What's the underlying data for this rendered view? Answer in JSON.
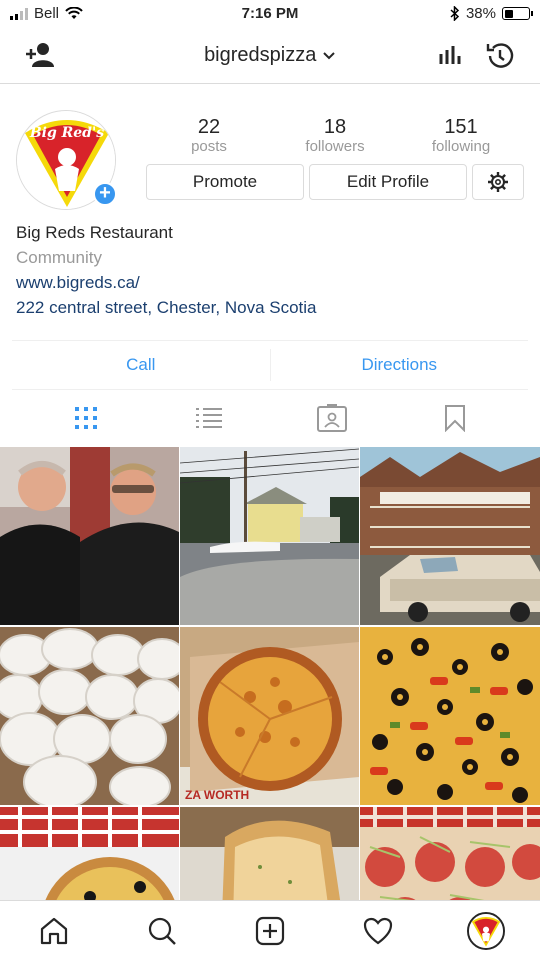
{
  "status": {
    "carrier": "Bell",
    "time": "7:16 PM",
    "battery": "38%",
    "battery_level": 0.38
  },
  "header": {
    "username": "bigredspizza"
  },
  "profile": {
    "avatar_text": "Big Red's",
    "stats": [
      {
        "value": "22",
        "label": "posts"
      },
      {
        "value": "18",
        "label": "followers"
      },
      {
        "value": "151",
        "label": "following"
      }
    ],
    "promote_label": "Promote",
    "edit_label": "Edit Profile",
    "name": "Big Reds Restaurant",
    "category": "Community",
    "website": "www.bigreds.ca/",
    "address": "222 central street, Chester, Nova Scotia"
  },
  "actions": {
    "call": "Call",
    "directions": "Directions"
  },
  "view_tabs": [
    "grid-icon",
    "list-icon",
    "tagged-icon",
    "saved-icon"
  ],
  "grid_posts": [
    "two men portrait",
    "street with house",
    "restaurant building",
    "pizza dough balls",
    "cheese pizza in box",
    "olive pizza closeup",
    "pizza with vegetables",
    "garlic bread",
    "sub sandwich"
  ],
  "bottom_nav": [
    "home-icon",
    "search-icon",
    "new-post-icon",
    "activity-icon",
    "profile-icon"
  ],
  "colors": {
    "accent": "#3897f0",
    "link": "#1b3f6f",
    "brand_red": "#d8232a",
    "brand_yellow": "#f5d90a"
  }
}
